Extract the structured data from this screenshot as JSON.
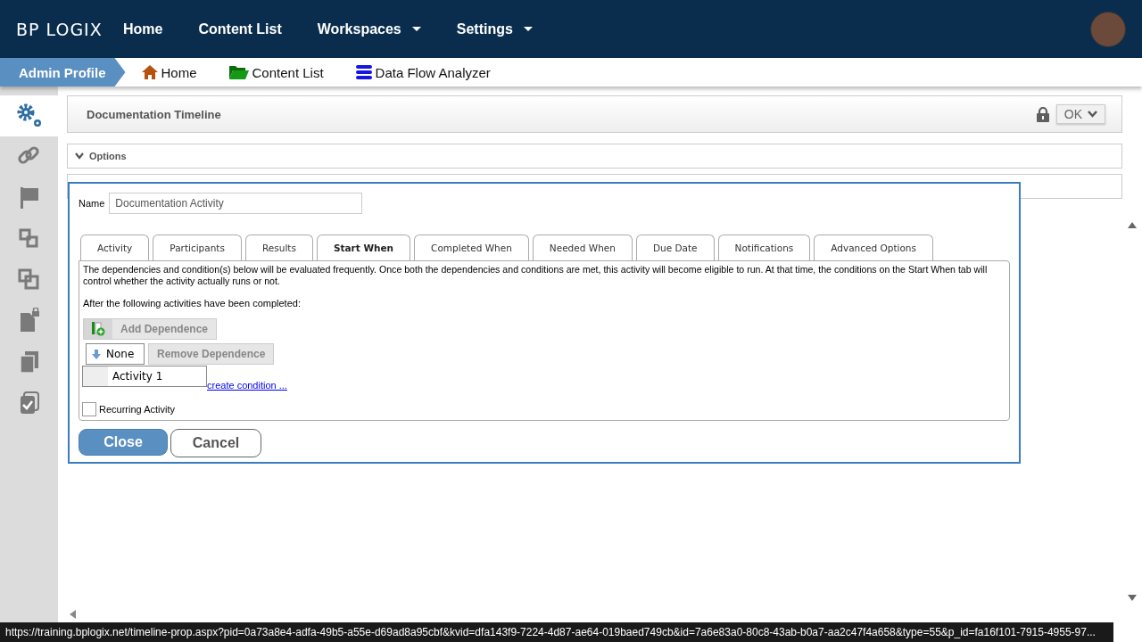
{
  "logo": "BP LOGIX",
  "nav": [
    {
      "label": "Home",
      "has_menu": false
    },
    {
      "label": "Content List",
      "has_menu": false
    },
    {
      "label": "Workspaces",
      "has_menu": true
    },
    {
      "label": "Settings",
      "has_menu": true
    }
  ],
  "breadcrumb": {
    "profile": "Admin Profile",
    "links": [
      {
        "label": "Home",
        "kind": "home"
      },
      {
        "label": "Content List",
        "kind": "folder"
      },
      {
        "label": "Data Flow Analyzer",
        "kind": "database"
      }
    ]
  },
  "sidebar": {
    "items": [
      {
        "kind": "gears",
        "selected": true
      },
      {
        "kind": "link",
        "selected": false
      },
      {
        "kind": "flag",
        "selected": false
      },
      {
        "kind": "boxes",
        "selected": false
      },
      {
        "kind": "boxes2",
        "selected": false
      },
      {
        "kind": "doclock",
        "selected": false
      },
      {
        "kind": "copies",
        "selected": false
      },
      {
        "kind": "checkdoc",
        "selected": false
      }
    ]
  },
  "page": {
    "title": "Documentation Timeline",
    "ok_button": "OK",
    "options_panel": "Options"
  },
  "dialog": {
    "name_label": "Name",
    "name_value": "Documentation Activity",
    "tabs": [
      {
        "label": "Activity",
        "selected": false
      },
      {
        "label": "Participants",
        "selected": false
      },
      {
        "label": "Results",
        "selected": false
      },
      {
        "label": "Start When",
        "selected": true
      },
      {
        "label": "Completed When",
        "selected": false
      },
      {
        "label": "Needed When",
        "selected": false
      },
      {
        "label": "Due Date",
        "selected": false
      },
      {
        "label": "Notifications",
        "selected": false
      },
      {
        "label": "Advanced Options",
        "selected": false
      }
    ],
    "description": "The dependencies and condition(s) below will be evaluated frequently. Once both the dependencies and conditions are met, this activity will become eligible to run. At that time, the conditions on the Start When tab will control whether the activity actually runs or not.",
    "after_text": "After the following activities have been completed:",
    "add_button": "Add Dependence",
    "dropdown": {
      "value": "None",
      "options": [
        "Activity 1"
      ]
    },
    "remove_button": "Remove Dependence",
    "condition_link": "create condition ...",
    "recurring": {
      "label": "Recurring Activity",
      "checked": false
    },
    "close_button": "Close",
    "cancel_button": "Cancel"
  },
  "status_url": "https://training.bplogix.net/timeline-prop.aspx?pid=0a73a8e4-adfa-49b5-a55e-d69ad8a95cbf&kvid=dfa143f9-7224-4d87-ae64-019baed749cb&id=7a6e83a0-80c8-43ab-b0a7-aa2c47f4a658&type=55&p_id=fa16f101-7915-4955-97..."
}
